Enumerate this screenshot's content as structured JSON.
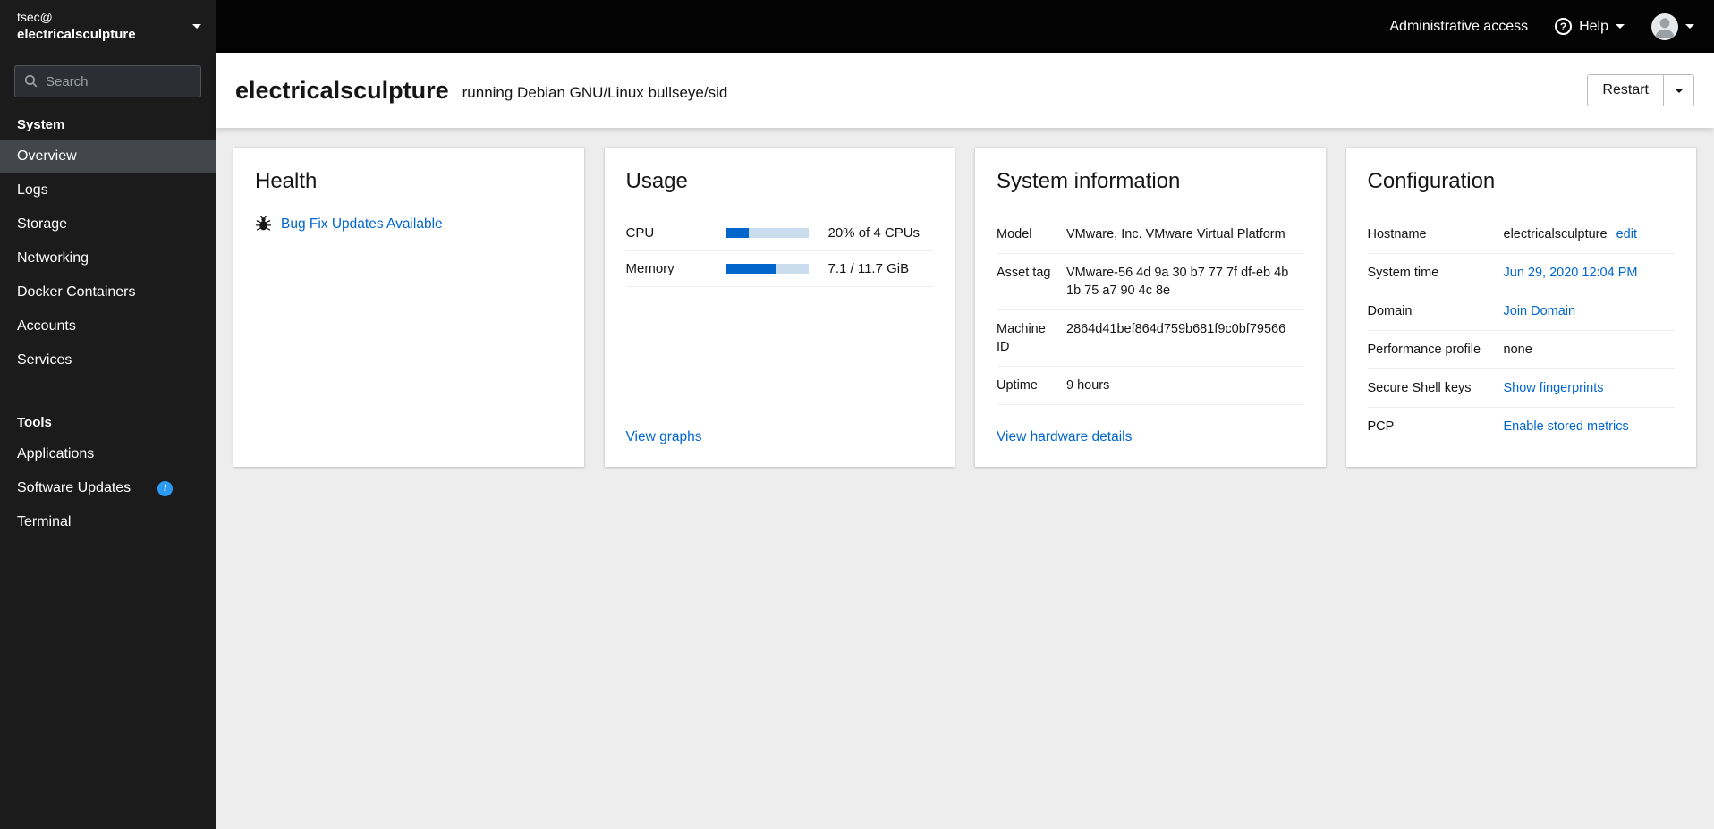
{
  "colors": {
    "accent_blue": "#0066cc",
    "info_badge_blue": "#2b9af3",
    "sidebar_bg": "#1b1b1b",
    "topbar_bg": "#030303",
    "content_bg": "#ededed"
  },
  "sidebar": {
    "user": "tsec@",
    "host": "electricalsculpture",
    "search_placeholder": "Search",
    "system_section_title": "System",
    "system_items": [
      "Overview",
      "Logs",
      "Storage",
      "Networking",
      "Docker Containers",
      "Accounts",
      "Services"
    ],
    "tools_section_title": "Tools",
    "tools_items": [
      "Applications",
      "Software Updates",
      "Terminal"
    ],
    "software_updates_badge": "i"
  },
  "topbar": {
    "admin_access_label": "Administrative access",
    "help_label": "Help",
    "help_glyph": "?"
  },
  "header": {
    "hostname": "electricalsculpture",
    "subtitle": "running Debian GNU/Linux bullseye/sid",
    "restart_label": "Restart"
  },
  "health": {
    "title": "Health",
    "update_link": "Bug Fix Updates Available"
  },
  "usage": {
    "title": "Usage",
    "rows": [
      {
        "label": "CPU",
        "value": "20% of 4 CPUs",
        "percent": 28
      },
      {
        "label": "Memory",
        "value": "7.1 / 11.7 GiB",
        "percent": 61
      }
    ],
    "view_graphs_label": "View graphs"
  },
  "system_info": {
    "title": "System information",
    "rows": [
      {
        "label": "Model",
        "value": "VMware, Inc. VMware Virtual Platform"
      },
      {
        "label": "Asset tag",
        "value": "VMware-56 4d 9a 30 b7 77 7f df-eb 4b 1b 75 a7 90 4c 8e"
      },
      {
        "label": "Machine ID",
        "value": "2864d41bef864d759b681f9c0bf79566"
      },
      {
        "label": "Uptime",
        "value": "9 hours"
      }
    ],
    "hardware_link_label": "View hardware details"
  },
  "configuration": {
    "title": "Configuration",
    "rows": [
      {
        "label": "Hostname",
        "value": "electricalsculpture",
        "link": "edit"
      },
      {
        "label": "System time",
        "link": "Jun 29, 2020 12:04 PM"
      },
      {
        "label": "Domain",
        "link": "Join Domain"
      },
      {
        "label": "Performance profile",
        "value": "none"
      },
      {
        "label": "Secure Shell keys",
        "link": "Show fingerprints"
      },
      {
        "label": "PCP",
        "link": "Enable stored metrics"
      }
    ]
  }
}
